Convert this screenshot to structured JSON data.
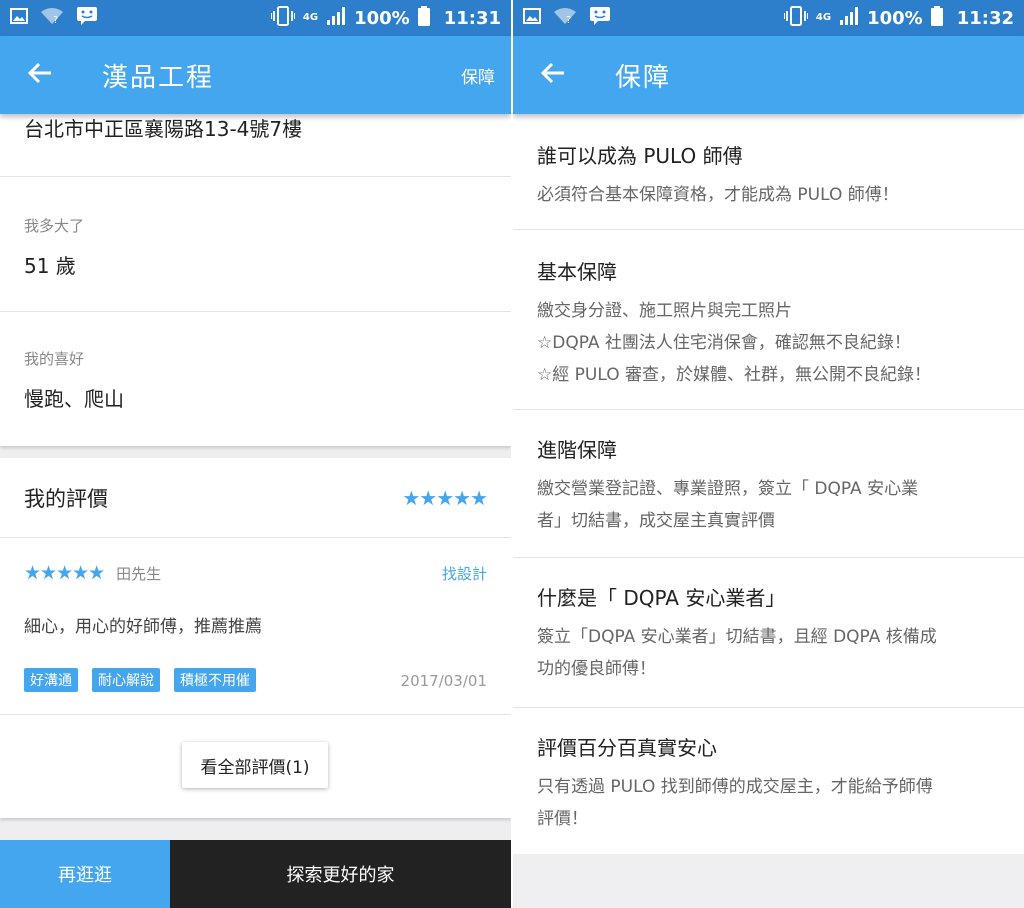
{
  "left": {
    "status": {
      "time": "11:31",
      "battery": "100%",
      "network": "4G"
    },
    "appbar": {
      "title": "漢品工程",
      "action": "保障"
    },
    "profile": {
      "address": "台北市中正區襄陽路13-4號7樓",
      "age_label": "我多大了",
      "age_value": "51 歲",
      "hobby_label": "我的喜好",
      "hobby_value": "慢跑、爬山"
    },
    "reviews": {
      "title": "我的評價",
      "overall_stars": "★★★★★",
      "item": {
        "stars": "★★★★★",
        "reviewer": "田先生",
        "kind": "找設計",
        "text": "細心，用心的好師傅，推薦推薦",
        "tags": [
          "好溝通",
          "耐心解說",
          "積極不用催"
        ],
        "date": "2017/03/01"
      },
      "all_button": "看全部評價(1)"
    },
    "bottom": {
      "browse": "再逛逛",
      "explore": "探索更好的家"
    }
  },
  "right": {
    "status": {
      "time": "11:32",
      "battery": "100%",
      "network": "4G"
    },
    "appbar": {
      "title": "保障"
    },
    "items": [
      {
        "title": "誰可以成為 PULO 師傅",
        "lines": [
          "必須符合基本保障資格，才能成為 PULO 師傅！"
        ]
      },
      {
        "title": "基本保障",
        "lines": [
          "繳交身分證、施工照片與完工照片",
          "☆DQPA 社團法人住宅消保會，確認無不良紀錄！",
          "☆經 PULO 審查，於媒體、社群，無公開不良紀錄！"
        ]
      },
      {
        "title": "進階保障",
        "lines": [
          "繳交營業登記證、專業證照，簽立「 DQPA 安心業",
          "者」切結書，成交屋主真實評價"
        ]
      },
      {
        "title": "什麼是「 DQPA 安心業者」",
        "lines": [
          "簽立「DQPA 安心業者」切結書，且經 DQPA 核備成",
          "功的優良師傅！"
        ]
      },
      {
        "title": "評價百分百真實安心",
        "lines": [
          "只有透過 PULO 找到師傅的成交屋主，才能給予師傅",
          "評價！"
        ]
      }
    ]
  },
  "colors": {
    "statusbar": "#2e7fcb",
    "appbar": "#44a6ee",
    "accent": "#44a6ee",
    "dark_button": "#222222"
  },
  "icons": [
    "image-icon",
    "wifi-icon",
    "message-icon",
    "vibrate-icon",
    "signal-icon",
    "battery-icon",
    "back-arrow-icon",
    "star-icon"
  ]
}
